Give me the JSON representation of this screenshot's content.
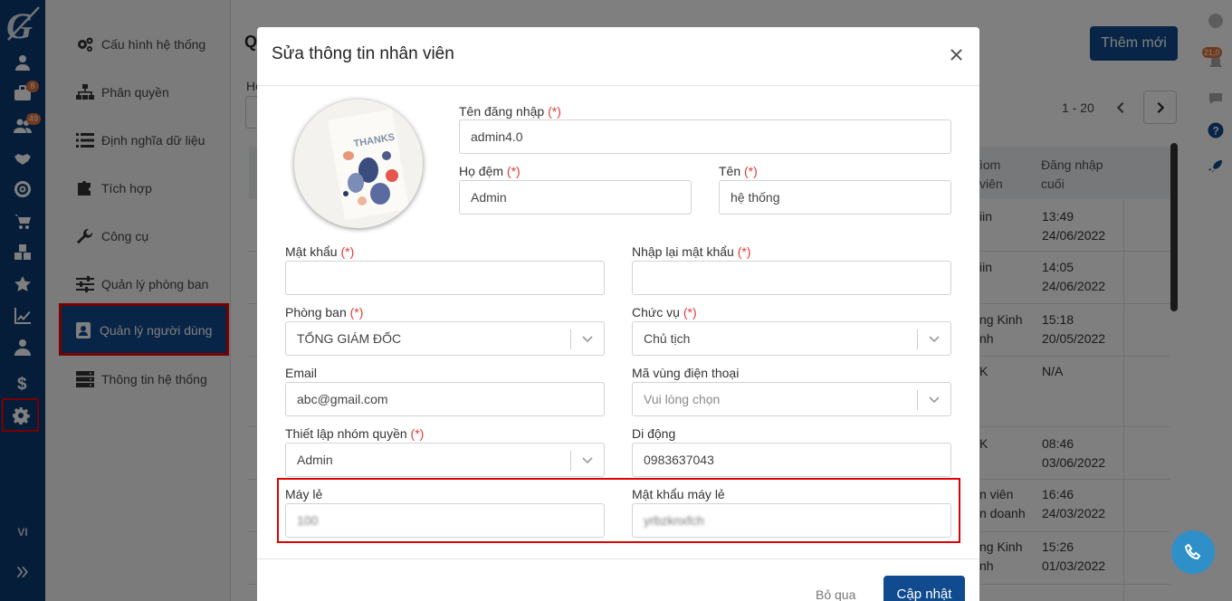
{
  "settings_menu": {
    "items": [
      {
        "label": "Cấu hình hệ thống"
      },
      {
        "label": "Phân quyền"
      },
      {
        "label": "Định nghĩa dữ liệu"
      },
      {
        "label": "Tích hợp"
      },
      {
        "label": "Công cụ"
      },
      {
        "label": "Quản lý phòng ban"
      },
      {
        "label": "Quản lý người dùng"
      },
      {
        "label": "Thông tin hệ thống"
      }
    ]
  },
  "rail": {
    "badges": {
      "briefcase": "8",
      "users": "49"
    },
    "language": "VI"
  },
  "background_page": {
    "title_fragment": "Q",
    "label_fragment": "Họ",
    "add_button": "Thêm mới",
    "pagination": "1 - 20",
    "columns": {
      "group_fragment": "ìom\nviên",
      "last_login": "Đăng nhập\ncuối"
    },
    "rows": [
      {
        "group": "iin",
        "last_login": "13:49\n24/06/2022"
      },
      {
        "group": "iin",
        "last_login": "14:05\n24/06/2022"
      },
      {
        "group": "ng Kinh\nnh",
        "last_login": "15:18\n20/05/2022"
      },
      {
        "group": "K",
        "last_login": "N/A"
      },
      {
        "group": "K",
        "last_login": "08:46\n03/06/2022"
      },
      {
        "group": "n viên\nn doanh",
        "last_login": "16:46\n24/03/2022"
      },
      {
        "group": "ng Kinh\nnh",
        "last_login": "15:26\n01/03/2022"
      }
    ]
  },
  "right_bar": {
    "badge": "21,0"
  },
  "modal": {
    "title": "Sửa thông tin nhân viên",
    "required_mark": "(*)",
    "fields": {
      "username": {
        "label": "Tên đăng nhập",
        "value": "admin4.0"
      },
      "middle_name": {
        "label": "Họ đệm",
        "value": "Admin"
      },
      "first_name": {
        "label": "Tên",
        "value": "hệ thống"
      },
      "password": {
        "label": "Mật khẩu",
        "value": ""
      },
      "confirm_password": {
        "label": "Nhập lại mật khẩu",
        "value": ""
      },
      "department": {
        "label": "Phòng ban",
        "value": "TỔNG GIÁM ĐỐC"
      },
      "position": {
        "label": "Chức vụ",
        "value": "Chủ tịch"
      },
      "email": {
        "label": "Email",
        "value": "abc@gmail.com"
      },
      "area_code": {
        "label": "Mã vùng điện thoại",
        "placeholder": "Vui lòng chọn"
      },
      "permission_group": {
        "label": "Thiết lập nhóm quyền",
        "value": "Admin"
      },
      "mobile": {
        "label": "Di động",
        "value": "0983637043"
      },
      "extension": {
        "label": "Máy lẻ",
        "value": "100"
      },
      "extension_password": {
        "label": "Mật khẩu máy lẻ",
        "value": "yrbzknxfch"
      }
    },
    "buttons": {
      "skip": "Bỏ qua",
      "update": "Cập nhật"
    }
  },
  "colors": {
    "primary": "#114b8f",
    "rail": "#0b3b72",
    "highlight": "#dd0000",
    "required": "#e53935"
  }
}
